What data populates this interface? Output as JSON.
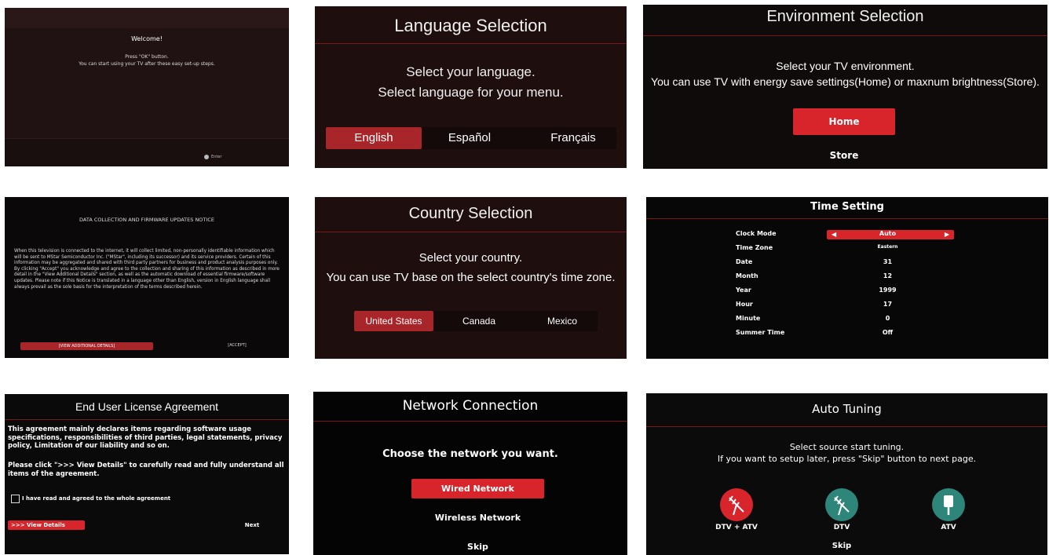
{
  "welcome": {
    "title": "Welcome!",
    "line1": "Press \"OK\" button.",
    "line2": "You can start using your TV after these easy set-up steps.",
    "footer": "Enter"
  },
  "language": {
    "title": "Language Selection",
    "line1": "Select your language.",
    "line2": "Select language for your menu.",
    "options": [
      "English",
      "Español",
      "Français"
    ]
  },
  "environment": {
    "title": "Environment Selection",
    "line1": "Select your TV environment.",
    "line2": "You can use TV with energy save settings(Home) or maxnum brightness(Store).",
    "options": [
      "Home",
      "Store"
    ]
  },
  "notice": {
    "title": "DATA COLLECTION AND FIRMWARE UPDATES NOTICE",
    "body": "When this television is connected to the internet, it will collect limited, non-personally identifiable information which will be sent to MStar Semiconductor Inc. (\"MStar\", including its successor) and its service providers. Certain of this information may be aggregated and shared with third party partners for business and product analysis purposes only. By clicking \"Accept\" you acknowledge and agree to the collection and sharing of this information as described in more detail in the \"View Additional Details\" section, as well as the automatic download of essential firmware/software updates. Please note if this Notice is translated in a language other than English, version in English language shall always prevail as the sole basis for the interpretation of the terms described herein.",
    "details_button": "[VIEW ADDITIONAL DETAILS]",
    "accept_button": "[ACCEPT]"
  },
  "country": {
    "title": "Country Selection",
    "line1": "Select your country.",
    "line2": "You can use TV base on the select country's time zone.",
    "options": [
      "United States",
      "Canada",
      "Mexico"
    ]
  },
  "time": {
    "title": "Time Setting",
    "rows": [
      {
        "label": "Clock Mode",
        "value": "Auto"
      },
      {
        "label": "Time Zone",
        "value": "Eastern"
      },
      {
        "label": "Date",
        "value": "31"
      },
      {
        "label": "Month",
        "value": "12"
      },
      {
        "label": "Year",
        "value": "1999"
      },
      {
        "label": "Hour",
        "value": "17"
      },
      {
        "label": "Minute",
        "value": "0"
      },
      {
        "label": "Summer Time",
        "value": "Off"
      }
    ]
  },
  "eula": {
    "title": "End User License Agreement",
    "para1": "This agreement mainly declares items regarding software usage specifications, responsibilities of third parties, legal statements, privacy policy, Limitation of our liability and so on.",
    "para2": "Please click \">>> View Details\" to carefully read and fully understand all items of the agreement.",
    "checkbox_label": "I have read and agreed to the whole agreement",
    "details_button": ">>> View Details",
    "next_button": "Next"
  },
  "network": {
    "title": "Network Connection",
    "prompt": "Choose the network you want.",
    "options": [
      "Wired Network",
      "Wireless Network",
      "Skip"
    ]
  },
  "tuning": {
    "title": "Auto Tuning",
    "line1": "Select source start tuning.",
    "line2": "If you want to setup later, press \"Skip\" button to next page.",
    "sources": [
      "DTV + ATV",
      "DTV",
      "ATV"
    ],
    "skip": "Skip"
  },
  "colors": {
    "accent": "#d8242b",
    "divider": "#7a1818",
    "teal": "#2e8579"
  }
}
